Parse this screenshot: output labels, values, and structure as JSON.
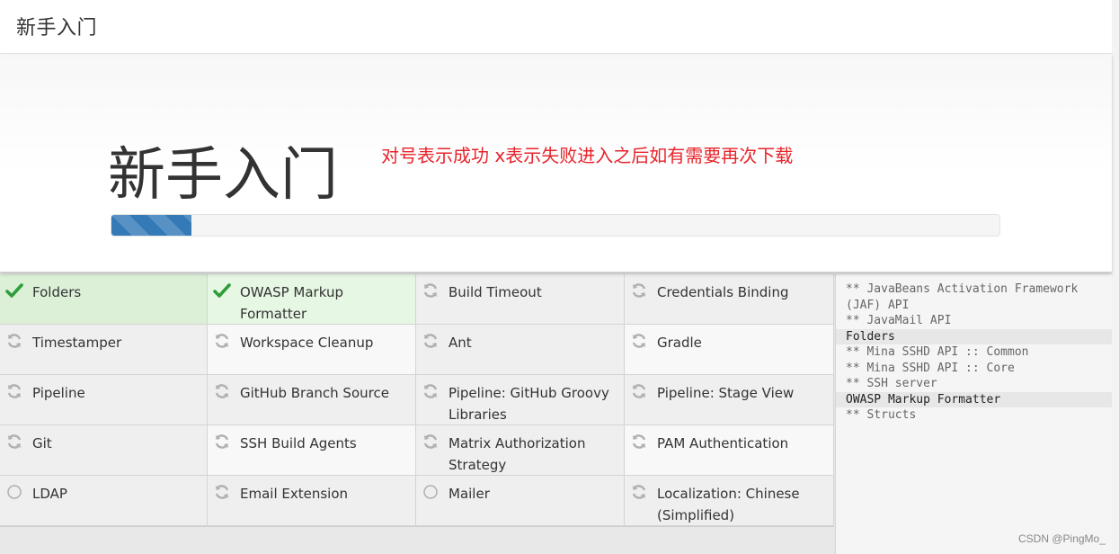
{
  "header": {
    "title": "新手入门"
  },
  "hero": {
    "title": "新手入门",
    "annotation": "对号表示成功 x表示失败进入之后如有需要再次下载",
    "progress": 0.09
  },
  "colors": {
    "success": "#2e9e3b",
    "pending": "#b0b0b0",
    "progress": "#337ab7",
    "annotation": "#e8242b"
  },
  "plugins": [
    {
      "name": "Folders",
      "status": "success"
    },
    {
      "name": "OWASP Markup Formatter",
      "status": "success"
    },
    {
      "name": "Build Timeout",
      "status": "pending"
    },
    {
      "name": "Credentials Binding",
      "status": "pending"
    },
    {
      "name": "Timestamper",
      "status": "pending"
    },
    {
      "name": "Workspace Cleanup",
      "status": "pending"
    },
    {
      "name": "Ant",
      "status": "pending"
    },
    {
      "name": "Gradle",
      "status": "pending"
    },
    {
      "name": "Pipeline",
      "status": "pending"
    },
    {
      "name": "GitHub Branch Source",
      "status": "pending"
    },
    {
      "name": "Pipeline: GitHub Groovy Libraries",
      "status": "pending"
    },
    {
      "name": "Pipeline: Stage View",
      "status": "pending"
    },
    {
      "name": "Git",
      "status": "pending"
    },
    {
      "name": "SSH Build Agents",
      "status": "pending"
    },
    {
      "name": "Matrix Authorization Strategy",
      "status": "pending"
    },
    {
      "name": "PAM Authentication",
      "status": "pending"
    },
    {
      "name": "LDAP",
      "status": "none"
    },
    {
      "name": "Email Extension",
      "status": "pending"
    },
    {
      "name": "Mailer",
      "status": "none"
    },
    {
      "name": "Localization: Chinese (Simplified)",
      "status": "pending"
    }
  ],
  "log": [
    {
      "text": "** JavaBeans Activation Framework (JAF) API",
      "done": false
    },
    {
      "text": "** JavaMail API",
      "done": false
    },
    {
      "text": "Folders",
      "done": true
    },
    {
      "text": "** Mina SSHD API :: Common",
      "done": false
    },
    {
      "text": "** Mina SSHD API :: Core",
      "done": false
    },
    {
      "text": "** SSH server",
      "done": false
    },
    {
      "text": "OWASP Markup Formatter",
      "done": true
    },
    {
      "text": "** Structs",
      "done": false
    }
  ],
  "watermark": "CSDN @PingMo_"
}
